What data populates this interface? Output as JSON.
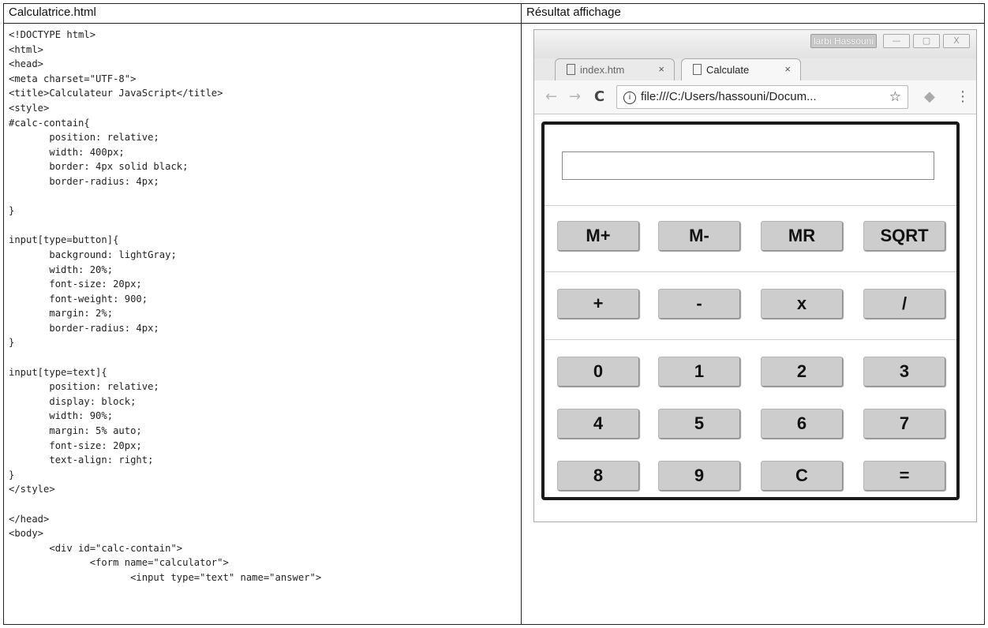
{
  "left_panel": {
    "heading": "Calculatrice.html",
    "code_lines": [
      "<!DOCTYPE html>",
      "<html>",
      "<head>",
      "<meta charset=\"UTF-8\">",
      "<title>Calculateur JavaScript</title>",
      "<style>",
      "#calc-contain{",
      "       position: relative;",
      "       width: 400px;",
      "       border: 4px solid black;",
      "       border-radius: 4px;",
      "",
      "}",
      "",
      "input[type=button]{",
      "       background: lightGray;",
      "       width: 20%;",
      "       font-size: 20px;",
      "       font-weight: 900;",
      "       margin: 2%;",
      "       border-radius: 4px;",
      "}",
      "",
      "input[type=text]{",
      "       position: relative;",
      "       display: block;",
      "       width: 90%;",
      "       margin: 5% auto;",
      "       font-size: 20px;",
      "       text-align: right;",
      "}",
      "</style>",
      "",
      "</head>",
      "<body>",
      "       <div id=\"calc-contain\">",
      "              <form name=\"calculator\">",
      "                     <input type=\"text\" name=\"answer\">"
    ]
  },
  "right_panel": {
    "heading": "Résultat affichage",
    "browser": {
      "user_name": "larbi Hassouni",
      "window_buttons": [
        "—",
        "▢",
        "X"
      ],
      "tabs": [
        {
          "label": "index.htm",
          "close": "×"
        },
        {
          "label": "Calculate",
          "close": "×"
        }
      ],
      "nav_back": "←",
      "nav_forward": "→",
      "reload": "C",
      "address_info": "i",
      "address": "file:///C:/Users/hassouni/Docum...",
      "bookmark": "☆",
      "extension": "◆",
      "menu": "⋮"
    },
    "calculator": {
      "display_value": "",
      "rows": [
        [
          "M+",
          "M-",
          "MR",
          "SQRT"
        ],
        [
          "+",
          "-",
          "x",
          "/"
        ],
        [
          "0",
          "1",
          "2",
          "3"
        ],
        [
          "4",
          "5",
          "6",
          "7"
        ],
        [
          "8",
          "9",
          "C",
          "="
        ]
      ]
    }
  }
}
